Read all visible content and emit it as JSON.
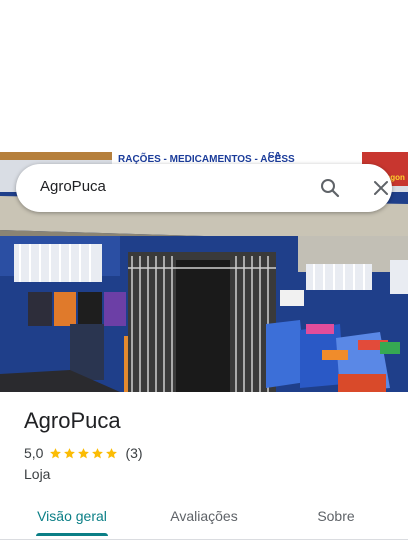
{
  "photo": {
    "alt_sign_text": "RAÇÕES - MEDICAMENTOS - ACESS",
    "sign_top_fragment": "CA",
    "sign_right_fragment": "Hagon"
  },
  "search": {
    "query": "AgroPuca"
  },
  "icons": {
    "search": "search-icon",
    "close": "close-icon",
    "star": "star-icon"
  },
  "place": {
    "name": "AgroPuca",
    "rating": "5,0",
    "stars": 5,
    "review_count": "(3)",
    "category": "Loja"
  },
  "tabs": [
    {
      "label": "Visão geral",
      "active": true
    },
    {
      "label": "Avaliações",
      "active": false
    },
    {
      "label": "Sobre",
      "active": false
    }
  ],
  "colors": {
    "accent": "#0b7f86",
    "star": "#fbbc04",
    "wall": "#1f3f8a"
  }
}
